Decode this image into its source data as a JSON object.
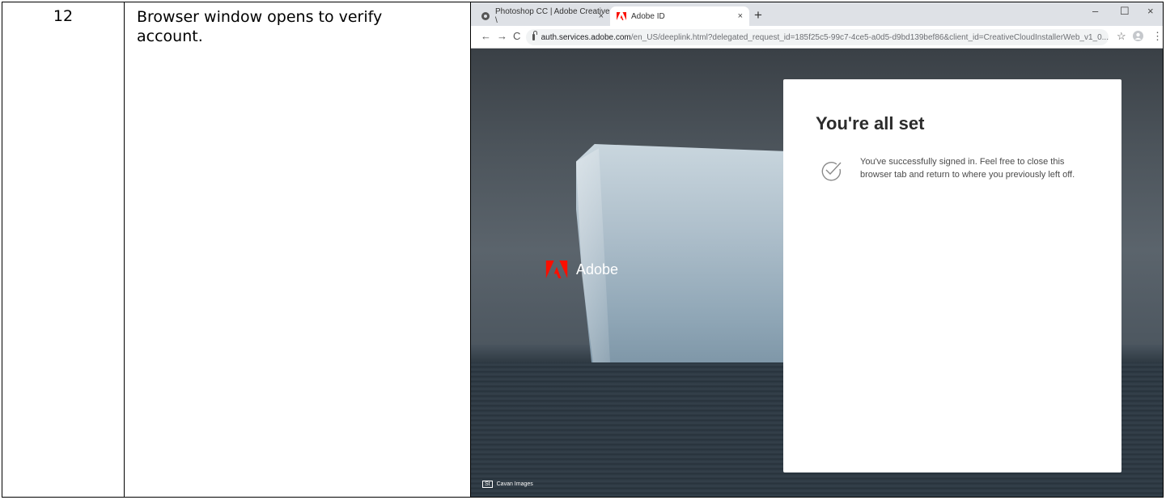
{
  "doc": {
    "step_number": "12",
    "step_description": "Browser window opens to verify account."
  },
  "browser": {
    "tabs": [
      {
        "title": "Photoshop CC | Adobe Creative \\",
        "close": "×"
      },
      {
        "title": "Adobe ID",
        "close": "×"
      }
    ],
    "new_tab": "+",
    "window_controls": {
      "minimize": "–",
      "maximize": "☐",
      "close": "×"
    },
    "nav": {
      "back": "←",
      "forward": "→",
      "reload": "C"
    },
    "url_host": "auth.services.adobe.com",
    "url_rest": "/en_US/deeplink.html?delegated_request_id=185f25c5-99c7-4ce5-a0d5-d9bd139bef86&client_id=CreativeCloudInstallerWeb_v1_0...",
    "toolbar_icons": {
      "bookmark": "☆",
      "menu": "⋮"
    }
  },
  "page": {
    "brand_name": "Adobe",
    "stock_badge": "St",
    "stock_credit": "Cavan Images",
    "card_title": "You're all set",
    "card_message": "You've successfully signed in. Feel free to close this browser tab and return to where you previously left off.",
    "colors": {
      "adobe_red": "#fa0f00",
      "card_bg": "#ffffff"
    }
  }
}
